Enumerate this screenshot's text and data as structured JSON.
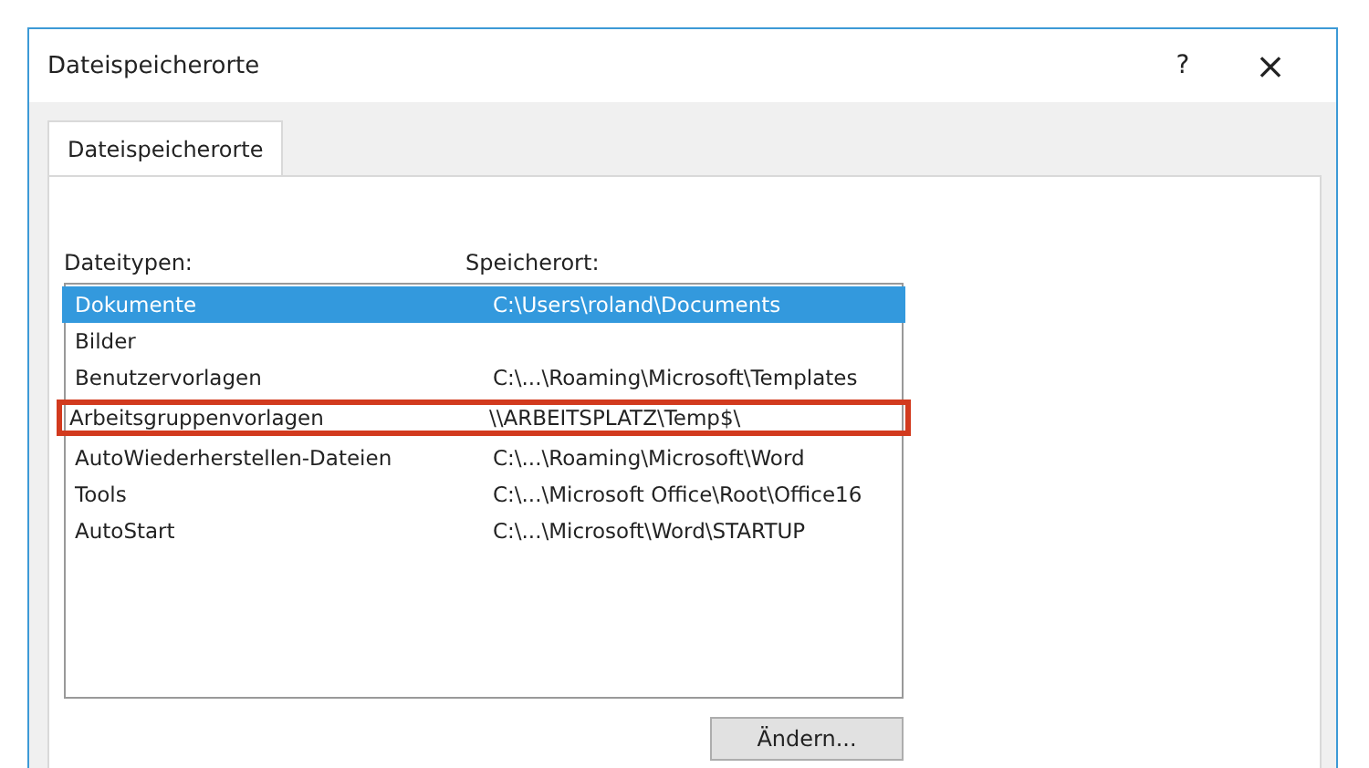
{
  "window": {
    "title": "Dateispeicherorte",
    "help": "?",
    "close": "×"
  },
  "tabs": [
    {
      "label": "Dateispeicherorte",
      "selected": true
    }
  ],
  "list": {
    "columns": [
      "Dateitypen:",
      "Speicherort:"
    ],
    "rows": [
      {
        "type": "Dokumente",
        "location": "C:\\Users\\roland\\Documents",
        "selected": true,
        "highlighted": false
      },
      {
        "type": "Bilder",
        "location": "",
        "selected": false,
        "highlighted": false
      },
      {
        "type": "Benutzervorlagen",
        "location": "C:\\...\\Roaming\\Microsoft\\Templates",
        "selected": false,
        "highlighted": false
      },
      {
        "type": "Arbeitsgruppenvorlagen",
        "location": "\\\\ARBEITSPLATZ\\Temp$\\",
        "selected": false,
        "highlighted": true
      },
      {
        "type": "AutoWiederherstellen-Dateien",
        "location": "C:\\...\\Roaming\\Microsoft\\Word",
        "selected": false,
        "highlighted": false
      },
      {
        "type": "Tools",
        "location": "C:\\...\\Microsoft Office\\Root\\Office16",
        "selected": false,
        "highlighted": false
      },
      {
        "type": "AutoStart",
        "location": "C:\\...\\Microsoft\\Word\\STARTUP",
        "selected": false,
        "highlighted": false
      }
    ]
  },
  "buttons": [
    "Ändern..."
  ]
}
